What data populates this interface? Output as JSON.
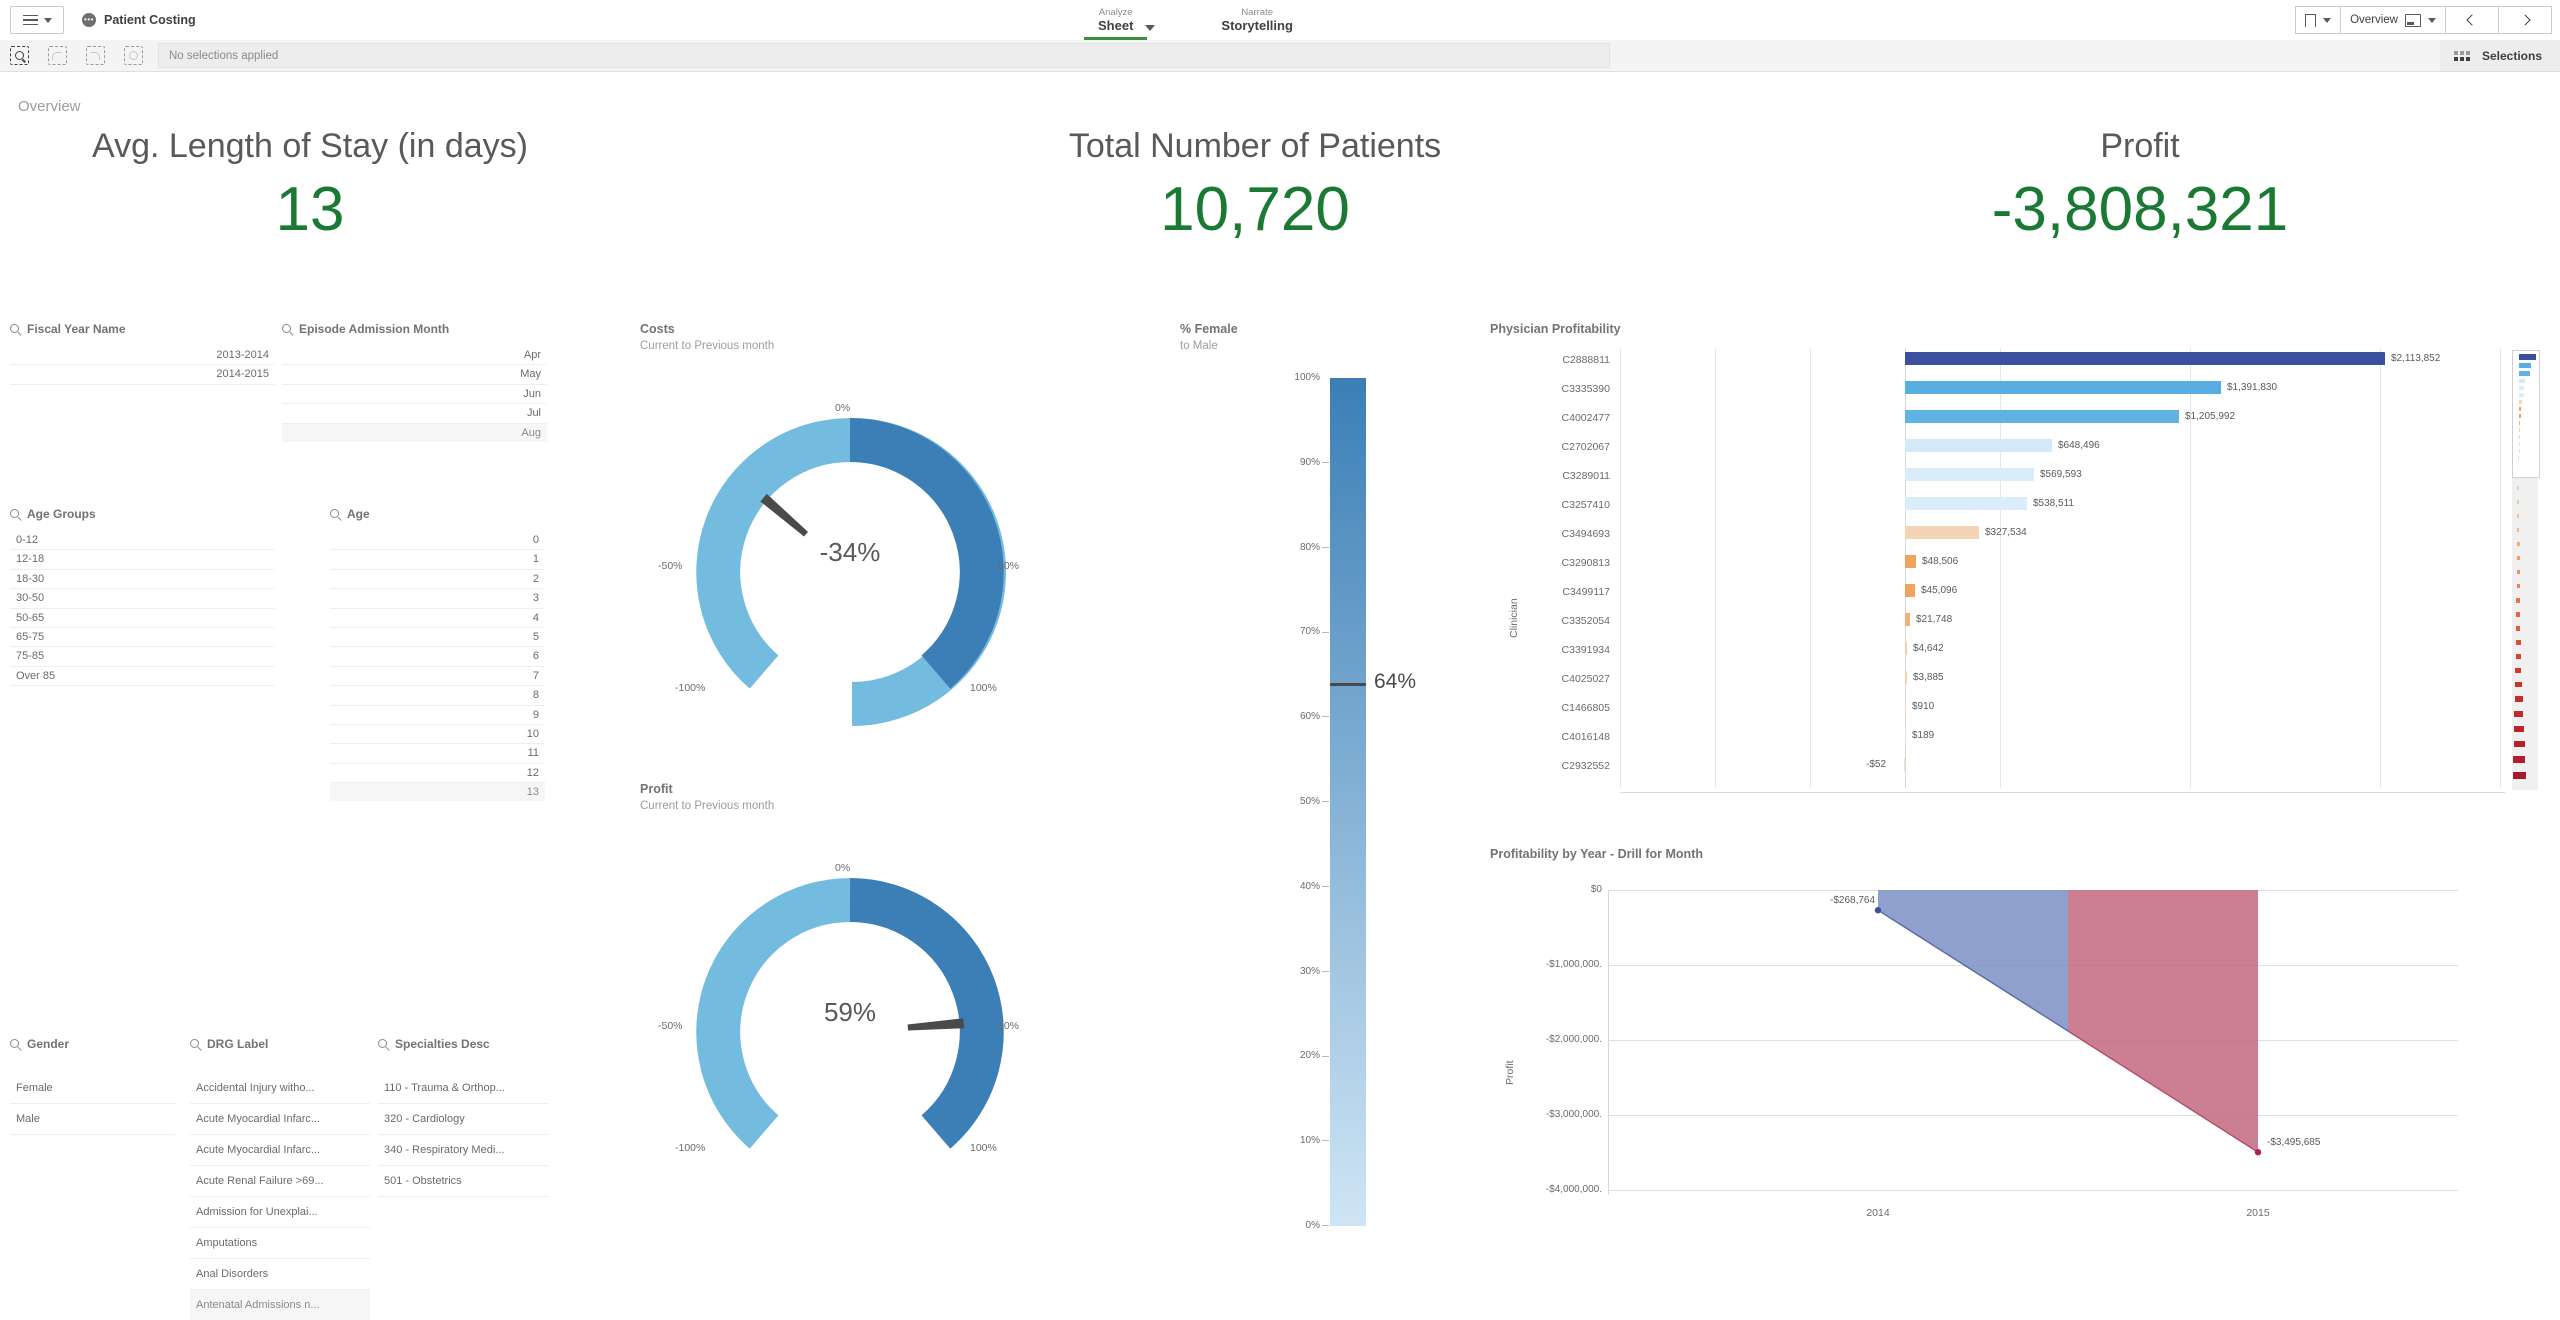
{
  "topnav": {
    "app_title": "Patient Costing",
    "menu_icon": "hamburger-icon",
    "tabs": [
      {
        "sup": "Analyze",
        "main": "Sheet",
        "active": true,
        "has_chevron": true
      },
      {
        "sup": "Narrate",
        "main": "Storytelling",
        "active": false,
        "has_chevron": false
      }
    ],
    "bookmark_icon": "bookmark-icon",
    "sheet_selector_label": "Overview",
    "sheet_icon": "sheet-icon",
    "prev_icon": "chevron-left-icon",
    "next_icon": "chevron-right-icon"
  },
  "selections_bar": {
    "search_icon": "selection-search-icon",
    "back_icon": "step-back-icon",
    "forward_icon": "step-forward-icon",
    "clear_icon": "clear-selections-icon",
    "status_text": "No selections applied",
    "selections_label": "Selections",
    "selections_icon": "selections-tool-icon"
  },
  "sheet": {
    "title": "Overview"
  },
  "kpis": [
    {
      "title": "Avg. Length of Stay (in days)",
      "value": "13"
    },
    {
      "title": "Total Number of Patients",
      "value": "10,720"
    },
    {
      "title": "Profit",
      "value": "-3,808,321"
    }
  ],
  "colors": {
    "kpi_green": "#1a7a34",
    "gauge_light": "#74bbe0",
    "gauge_dark": "#3b7fb6",
    "needle": "#4a4a4a",
    "bar_navy": "#3a4f9e",
    "bar_blue": "#58aee0",
    "bar_pale": "#d3e9f8",
    "bar_peach": "#f3d4b4",
    "bar_orange": "#f0a55e",
    "area_blue": "#7d8fc4",
    "area_red": "#c3697f",
    "accent_green": "#3f8e3f"
  },
  "filter_panes": [
    {
      "name": "Fiscal Year Name",
      "align": "right",
      "values": [
        "2013-2014",
        "2014-2015"
      ],
      "faded_last": false
    },
    {
      "name": "Episode Admission Month",
      "align": "right",
      "values": [
        "Apr",
        "May",
        "Jun",
        "Jul",
        "Aug"
      ],
      "faded_last": true
    },
    {
      "name": "Age Groups",
      "align": "left",
      "values": [
        "0-12",
        "12-18",
        "18-30",
        "30-50",
        "50-65",
        "65-75",
        "75-85",
        "Over 85"
      ],
      "faded_last": false
    },
    {
      "name": "Age",
      "align": "right",
      "values": [
        "0",
        "1",
        "2",
        "3",
        "4",
        "5",
        "6",
        "7",
        "8",
        "9",
        "10",
        "11",
        "12",
        "13"
      ],
      "faded_last": true
    },
    {
      "name": "Gender",
      "align": "left",
      "values": [
        "Female",
        "Male"
      ],
      "faded_last": false
    },
    {
      "name": "DRG Label",
      "align": "left",
      "values": [
        "Accidental Injury witho...",
        "Acute Myocardial Infarc...",
        "Acute Myocardial Infarc...",
        "Acute Renal Failure >69...",
        "Admission for Unexplai...",
        "Amputations",
        "Anal Disorders",
        "Antenatal Admissions n..."
      ],
      "faded_last": true
    },
    {
      "name": "Specialties Desc",
      "align": "left",
      "values": [
        "110 - Trauma & Orthop...",
        "320 - Cardiology",
        "340 - Respiratory Medi...",
        "501 - Obstetrics"
      ],
      "faded_last": false
    }
  ],
  "chart_data": [
    {
      "id": "costs_gauge",
      "type": "gauge",
      "title": "Costs",
      "subtitle": "Current to Previous month",
      "value": -34,
      "value_label": "-34%",
      "min": -100,
      "max": 100,
      "tick_labels": [
        "0%",
        "50%",
        "100%",
        "-100%",
        "-50%"
      ],
      "segments": [
        {
          "from": -100,
          "to": 0,
          "color": "#74bbe0"
        },
        {
          "from": 0,
          "to": 100,
          "color": "#3b7fb6"
        }
      ]
    },
    {
      "id": "profit_gauge",
      "type": "gauge",
      "title": "Profit",
      "subtitle": "Current to Previous month",
      "value": 59,
      "value_label": "59%",
      "min": -100,
      "max": 100,
      "tick_labels": [
        "0%",
        "50%",
        "100%",
        "-100%",
        "-50%"
      ],
      "segments": [
        {
          "from": -100,
          "to": 0,
          "color": "#74bbe0"
        },
        {
          "from": 0,
          "to": 100,
          "color": "#3b7fb6"
        }
      ]
    },
    {
      "id": "pct_female",
      "type": "bar",
      "title": "% Female",
      "subtitle": "to Male",
      "orientation": "vertical-gradient",
      "value": 64,
      "value_label": "64%",
      "ylim": [
        0,
        100
      ],
      "ytick_labels": [
        "100%",
        "90%",
        "80%",
        "70%",
        "60%",
        "50%",
        "40%",
        "30%",
        "20%",
        "10%",
        "0%"
      ],
      "ytick_values": [
        100,
        90,
        80,
        70,
        60,
        50,
        40,
        30,
        20,
        10,
        0
      ]
    },
    {
      "id": "physician_profitability",
      "type": "bar",
      "title": "Physician Profitability",
      "ylabel": "Clinician",
      "orientation": "horizontal",
      "categories": [
        "C2888811",
        "C3335390",
        "C4002477",
        "C2702067",
        "C3289011",
        "C3257410",
        "C3494693",
        "C3290813",
        "C3499117",
        "C3352054",
        "C3391934",
        "C4025027",
        "C1466805",
        "C4016148",
        "C2932552"
      ],
      "values": [
        2113852,
        1391830,
        1205992,
        648496,
        569593,
        538511,
        327534,
        48506,
        45096,
        21748,
        4642,
        3885,
        910,
        189,
        -52
      ],
      "value_labels": [
        "$2,113,852",
        "$1,391,830",
        "$1,205,992",
        "$648,496",
        "$569,593",
        "$538,511",
        "$327,534",
        "$48,506",
        "$45,096",
        "$21,748",
        "$4,642",
        "$3,885",
        "$910",
        "$189",
        "-$52"
      ],
      "bar_colors": [
        "#3a4f9e",
        "#58aee0",
        "#5fb2e2",
        "#d3e9f8",
        "#d8ecf9",
        "#daedfa",
        "#f3d4b4",
        "#f0a55e",
        "#f0a55e",
        "#f2b174",
        "#f6cda5",
        "#f7d2ae",
        "#f8d9bb",
        "#f9dcc1",
        "#f9dcc1"
      ],
      "xlim": [
        -1000000,
        2400000
      ],
      "grid": true
    },
    {
      "id": "profitability_by_year",
      "type": "area",
      "title": "Profitability by Year - Drill for Month",
      "ylabel": "Profit",
      "categories": [
        "2014",
        "2015"
      ],
      "values": [
        -268764,
        -3495685
      ],
      "value_labels": [
        "-$268,764",
        "-$3,495,685"
      ],
      "ylim": [
        -4000000,
        0
      ],
      "ytick_labels": [
        "$0",
        "-$1,000,000.",
        "-$2,000,000.",
        "-$3,000,000.",
        "-$4,000,000."
      ],
      "ytick_values": [
        0,
        -1000000,
        -2000000,
        -3000000,
        -4000000
      ],
      "fill_colors": [
        "#7d8fc4",
        "#c3697f"
      ],
      "grid": true
    }
  ]
}
